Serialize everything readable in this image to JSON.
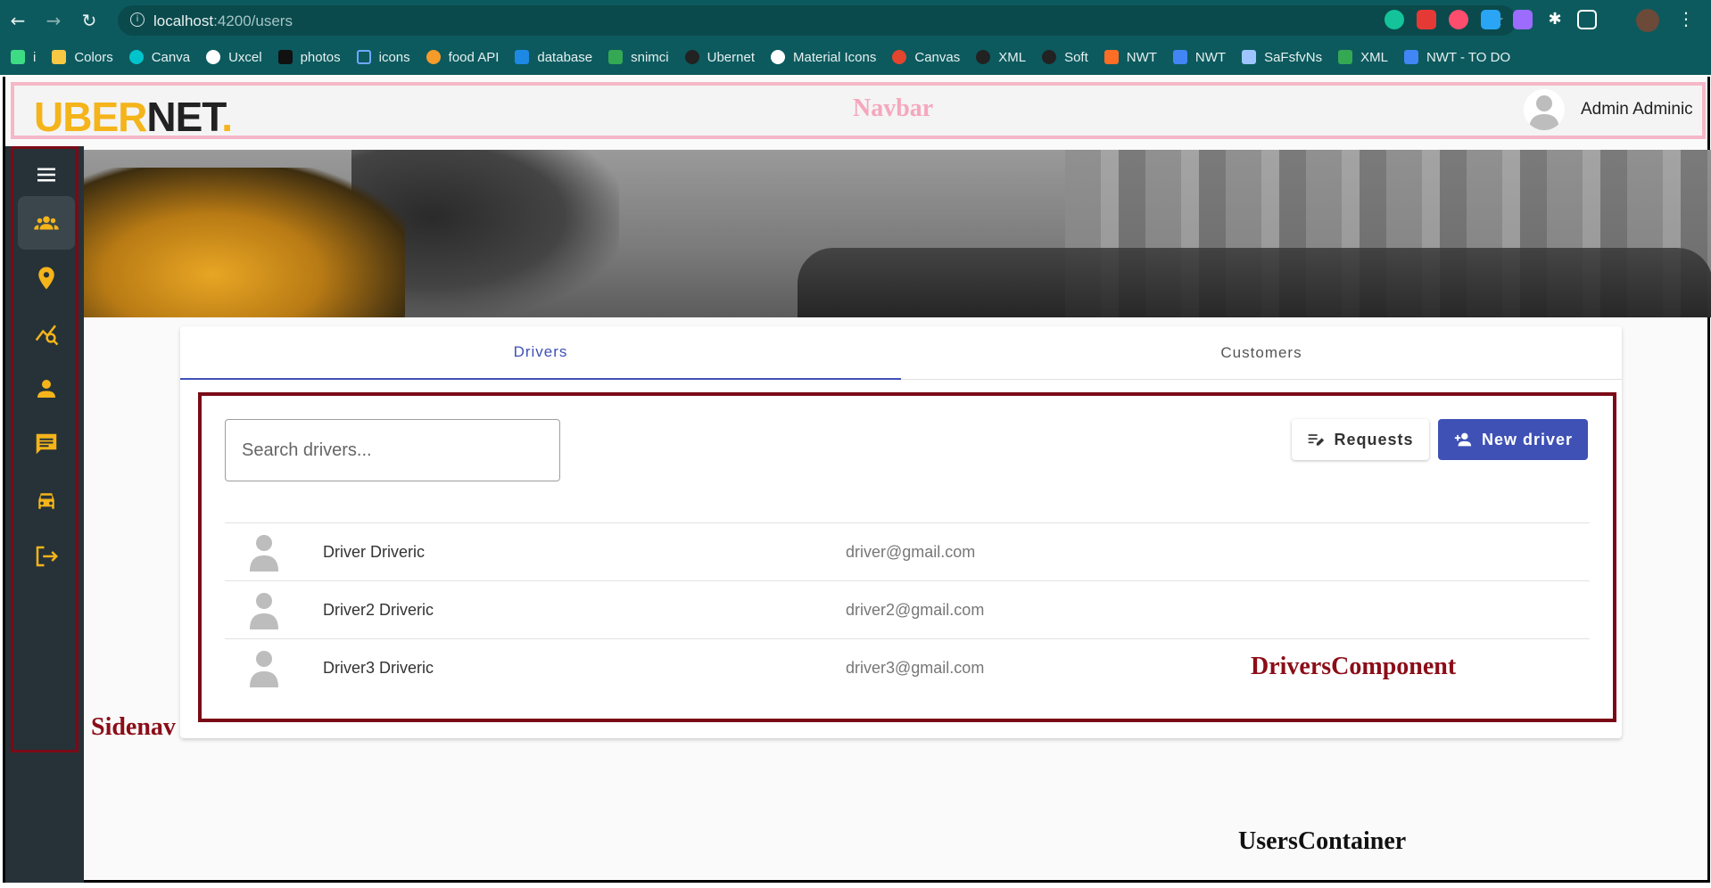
{
  "browser": {
    "url_host": "localhost",
    "url_rest": ":4200/users",
    "bookmarks": [
      "i",
      "Colors",
      "Canva",
      "Uxcel",
      "photos",
      "icons",
      "food API",
      "database",
      "snimci",
      "Ubernet",
      "Material Icons",
      "Canvas",
      "XML",
      "Soft",
      "NWT",
      "NWT",
      "SaFsfvNs",
      "XML",
      "NWT - TO DO"
    ]
  },
  "navbar": {
    "logo_part1": "UBER",
    "logo_part2": "NET",
    "logo_dot": ".",
    "annotation": "Navbar",
    "user_name": "Admin Adminic"
  },
  "sidenav": {
    "annotation": "Sidenav",
    "items": [
      "menu-icon",
      "users-icon",
      "location-pin-icon",
      "analytics-icon",
      "person-icon",
      "chat-icon",
      "car-icon",
      "logout-icon"
    ]
  },
  "tabs": {
    "drivers": "Drivers",
    "customers": "Customers"
  },
  "drivers": {
    "search_placeholder": "Search drivers...",
    "requests_label": "Requests",
    "new_driver_label": "New driver",
    "annotation": "DriversComponent",
    "rows": [
      {
        "name": "Driver Driveric",
        "email": "driver@gmail.com"
      },
      {
        "name": "Driver2 Driveric",
        "email": "driver2@gmail.com"
      },
      {
        "name": "Driver3 Driveric",
        "email": "driver3@gmail.com"
      }
    ]
  },
  "container_annotation": "UsersContainer",
  "colors": {
    "primary": "#3f51b5",
    "accent_yellow": "#f4b41a",
    "sidenav_bg": "#263238",
    "annotation_red": "#8b0d18",
    "navbar_border": "#f5b8c8"
  }
}
